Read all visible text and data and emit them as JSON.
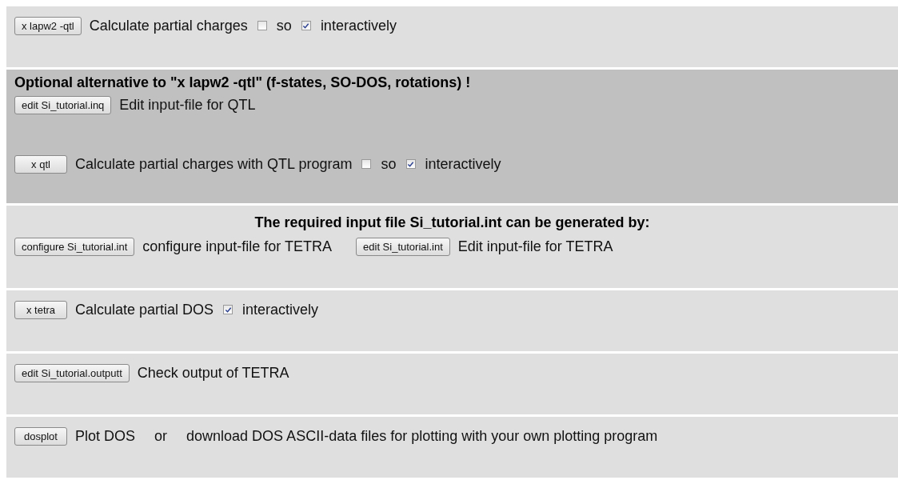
{
  "sections": [
    {
      "highlighted": false,
      "rows": [
        [
          {
            "kind": "button",
            "label": "x lapw2 -qtl"
          },
          {
            "kind": "text",
            "label": "Calculate partial charges"
          },
          {
            "kind": "checkbox",
            "label": "so",
            "checked": false
          },
          {
            "kind": "checkbox",
            "label": "interactively",
            "checked": true
          }
        ]
      ]
    },
    {
      "highlighted": true,
      "heading": "Optional alternative to \"x lapw2 -qtl\" (f-states, SO-DOS, rotations) !",
      "centered": false,
      "rows": [
        [
          {
            "kind": "button",
            "label": "edit Si_tutorial.inq"
          },
          {
            "kind": "text",
            "label": "Edit input-file for QTL"
          }
        ],
        [
          {
            "kind": "button",
            "label": "x qtl"
          },
          {
            "kind": "text",
            "label": "Calculate partial charges with QTL program"
          },
          {
            "kind": "checkbox",
            "label": "so",
            "checked": false
          },
          {
            "kind": "checkbox",
            "label": "interactively",
            "checked": true
          }
        ]
      ]
    },
    {
      "highlighted": false,
      "heading": "The required input file Si_tutorial.int can be generated by:",
      "centered": true,
      "rows": [
        [
          {
            "kind": "button",
            "label": "configure Si_tutorial.int"
          },
          {
            "kind": "text",
            "label": "configure input-file for TETRA"
          },
          {
            "kind": "button",
            "label": "edit Si_tutorial.int"
          },
          {
            "kind": "text",
            "label": "Edit input-file for TETRA"
          }
        ]
      ]
    },
    {
      "highlighted": false,
      "rows": [
        [
          {
            "kind": "button",
            "label": "x tetra"
          },
          {
            "kind": "text",
            "label": "Calculate partial DOS"
          },
          {
            "kind": "checkbox",
            "label": "interactively",
            "checked": true
          }
        ]
      ]
    },
    {
      "highlighted": false,
      "rows": [
        [
          {
            "kind": "button",
            "label": "edit Si_tutorial.outputt"
          },
          {
            "kind": "text",
            "label": "Check output of TETRA"
          }
        ]
      ]
    },
    {
      "highlighted": false,
      "rows": [
        [
          {
            "kind": "button",
            "label": "dosplot"
          },
          {
            "kind": "text",
            "label": "Plot DOS"
          },
          {
            "kind": "text",
            "label": "or"
          },
          {
            "kind": "text",
            "label": "download DOS ASCII-data files for plotting with your own plotting program"
          }
        ]
      ]
    }
  ]
}
